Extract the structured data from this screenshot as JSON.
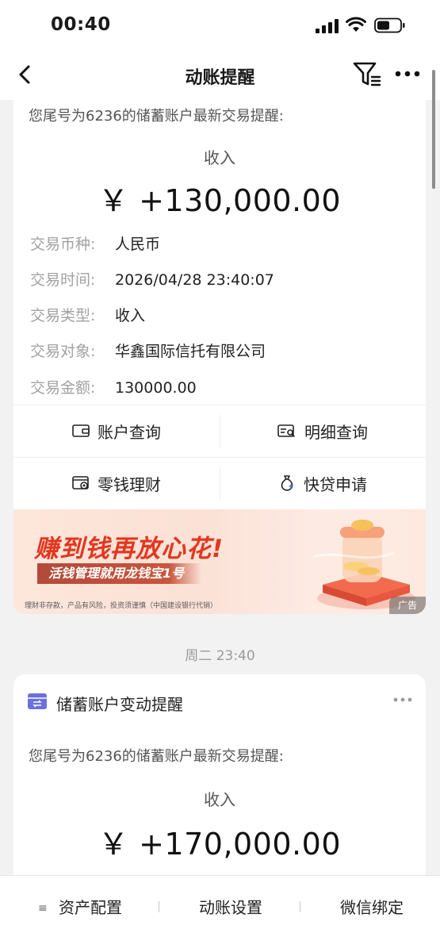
{
  "status_bar": {
    "time": "00:40"
  },
  "nav": {
    "title": "动账提醒",
    "back_icon": "chevron-left-icon",
    "filter_icon": "filter-icon",
    "more_icon": "more-dots-icon"
  },
  "card1": {
    "intro": "您尾号为6236的储蓄账户最新交易提醒:",
    "kind": "收入",
    "amount": "￥ +130,000.00",
    "rows": [
      {
        "label": "交易币种:",
        "value": "人民币"
      },
      {
        "label": "交易时间:",
        "value": "2026/04/28 23:40:07"
      },
      {
        "label": "交易类型:",
        "value": "收入"
      },
      {
        "label": "交易对象:",
        "value": "华鑫国际信托有限公司"
      },
      {
        "label": "交易金额:",
        "value": "130000.00"
      }
    ],
    "actions": [
      {
        "label": "账户查询",
        "icon": "wallet-icon"
      },
      {
        "label": "明细查询",
        "icon": "detail-search-icon"
      },
      {
        "label": "零钱理财",
        "icon": "finance-icon"
      },
      {
        "label": "快贷申请",
        "icon": "loan-bag-icon"
      }
    ]
  },
  "banner": {
    "headline": "赚到钱再放心花!",
    "tagline": "活钱管理就用龙钱宝1号",
    "fine_print": "理财非存款，产品有风险，投资须谨慎（中国建设银行代销）",
    "ad_label": "广告"
  },
  "day_stamp": "周二 23:40",
  "card2": {
    "title": "储蓄账户变动提醒",
    "intro": "您尾号为6236的储蓄账户最新交易提醒:",
    "kind": "收入",
    "amount": "￥ +170,000.00"
  },
  "bottom_tabs": [
    {
      "label": "资产配置"
    },
    {
      "label": "动账设置"
    },
    {
      "label": "微信绑定"
    }
  ],
  "colors": {
    "accent_red": "#e2371f",
    "card_icon": "#6b6fe0",
    "label_gray": "#a2a2a2"
  }
}
